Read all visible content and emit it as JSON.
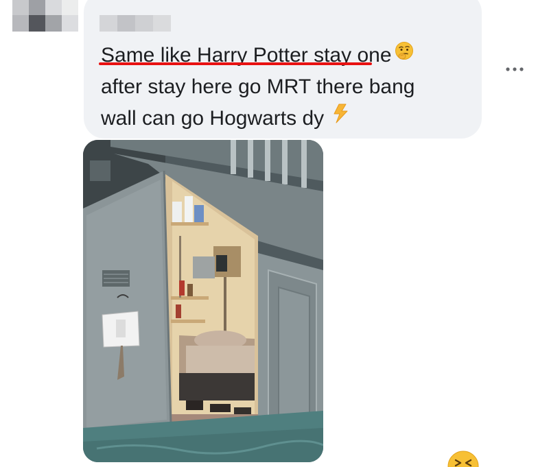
{
  "comment": {
    "lines": [
      "Same like Harry Potter stay one",
      "after stay here go MRT there bang",
      "wall can go Hogwarts dy"
    ],
    "emoji_after_line1": "thinking-face-icon",
    "emoji_after_line3": "lightning-bolt-icon",
    "underline_color": "#e81212",
    "bubble_color": "#f0f2f5",
    "text_color": "#1c1e21"
  },
  "more_options_icon": "more-horizontal-icon",
  "reaction_icon": "laughing-face-icon"
}
